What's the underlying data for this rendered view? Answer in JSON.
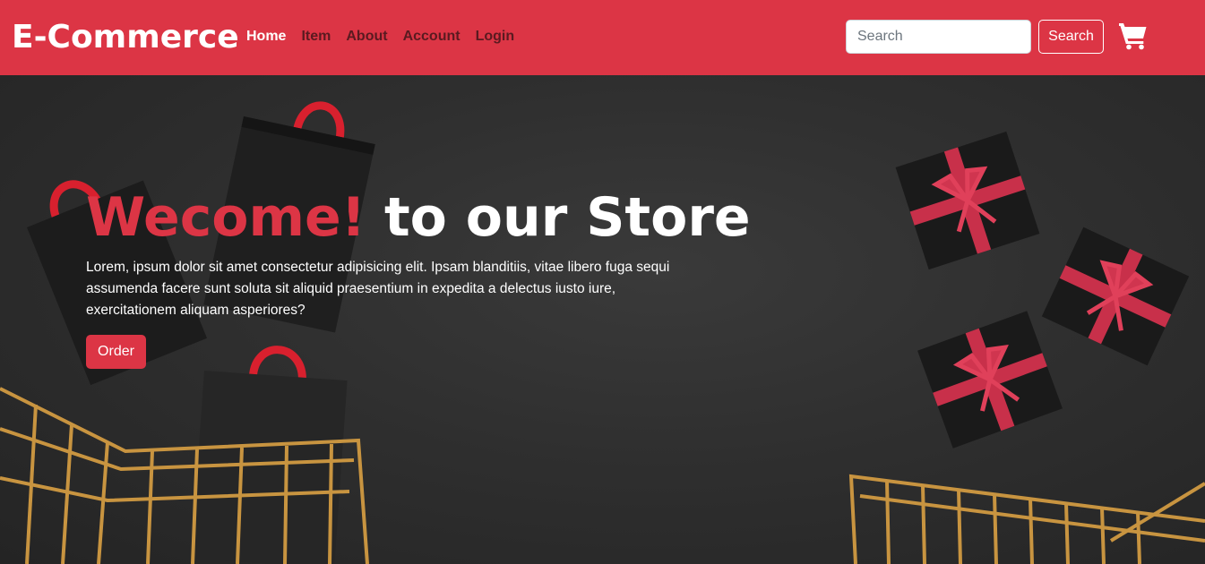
{
  "navbar": {
    "brand": "E-Commerce",
    "links": [
      {
        "label": "Home",
        "active": true
      },
      {
        "label": "Item",
        "active": false
      },
      {
        "label": "About",
        "active": false
      },
      {
        "label": "Account",
        "active": false
      },
      {
        "label": "Login",
        "active": false
      }
    ],
    "search": {
      "placeholder": "Search",
      "value": ""
    },
    "search_button": "Search",
    "cart_icon": "shopping-cart-icon"
  },
  "hero": {
    "title_accent": "Wecome!",
    "title_rest": " to our Store",
    "text": "Lorem, ipsum dolor sit amet consectetur adipisicing elit. Ipsam blanditiis, vitae libero fuga sequi assumenda facere sunt soluta sit aliquid praesentium in expedita a delectus iusto iure, exercitationem aliquam asperiores?",
    "order_button": "Order"
  },
  "colors": {
    "brand_red": "#dc3545",
    "hero_background": "#2b2b2b",
    "bag_handle": "#e02030",
    "cart_gold": "#c89440"
  }
}
